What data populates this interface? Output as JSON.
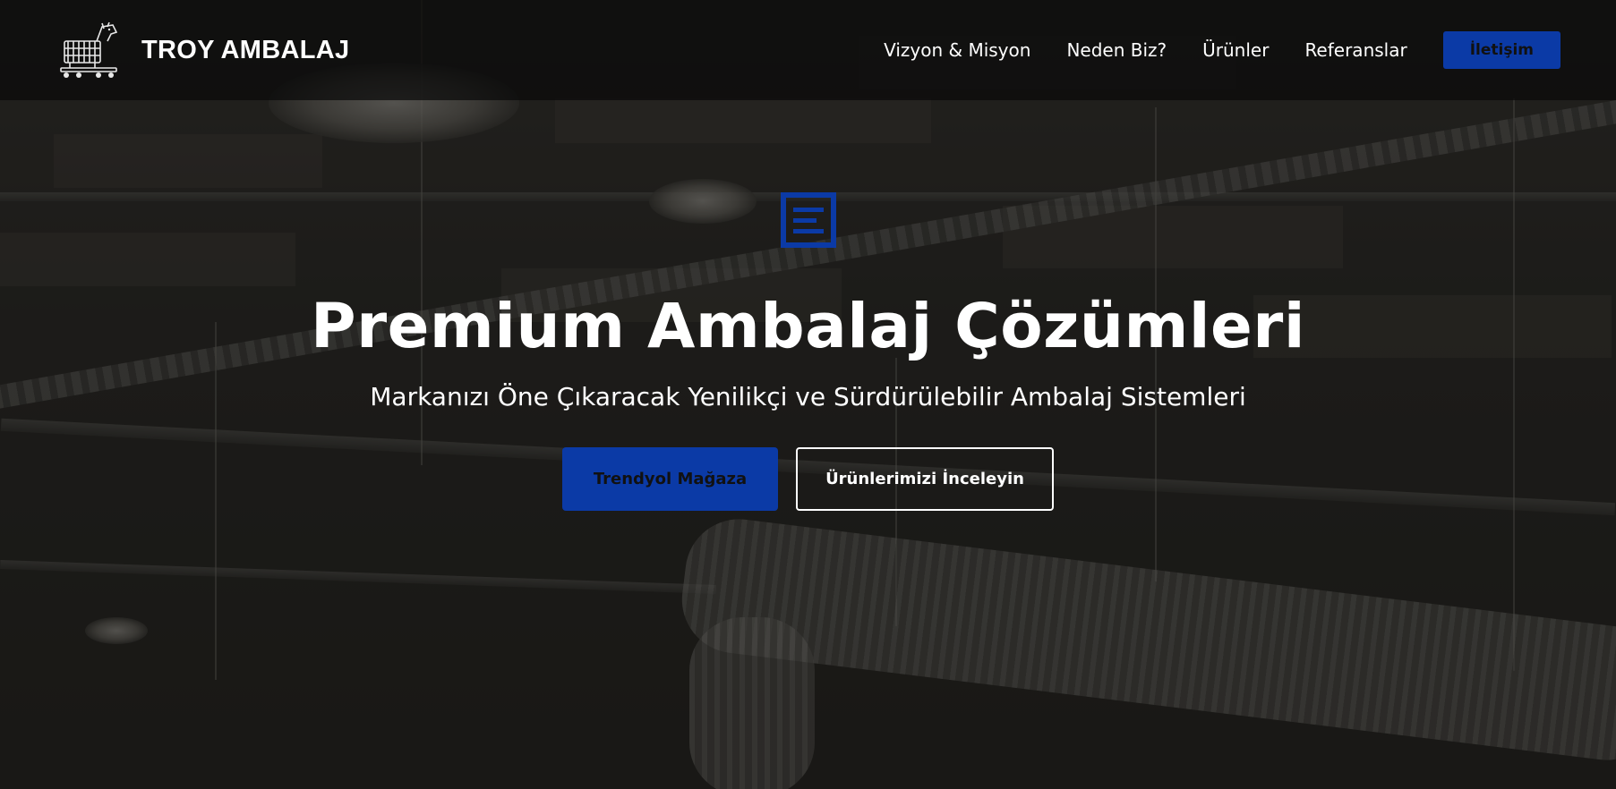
{
  "brand": {
    "name": "TROY AMBALAJ",
    "logo_icon": "trojan-horse-icon"
  },
  "nav": {
    "items": [
      {
        "label": "Vizyon & Misyon"
      },
      {
        "label": "Neden Biz?"
      },
      {
        "label": "Ürünler"
      },
      {
        "label": "Referanslar"
      }
    ],
    "cta_label": "İletişim"
  },
  "hero": {
    "icon": "document-box-icon",
    "title": "Premium Ambalaj Çözümleri",
    "subtitle": "Markanızı Öne Çıkaracak Yenilikçi ve Sürdürülebilir Ambalaj Sistemleri",
    "primary_button": "Trendyol Mağaza",
    "secondary_button": "Ürünlerimizi İnceleyin"
  },
  "colors": {
    "accent": "#0b3aa6",
    "navbar_bg": "rgba(10,10,10,0.72)",
    "text": "#ffffff"
  }
}
